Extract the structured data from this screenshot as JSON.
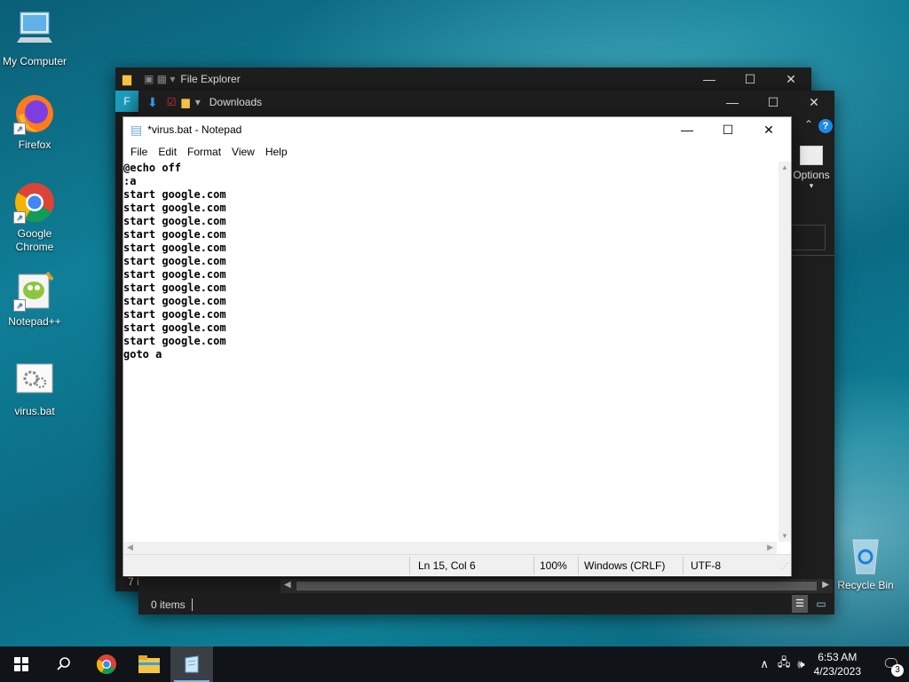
{
  "desktop": {
    "icons": [
      {
        "label": "My Computer"
      },
      {
        "label": "Firefox"
      },
      {
        "label": "Google Chrome"
      },
      {
        "label": "Notepad++"
      },
      {
        "label": "virus.bat"
      },
      {
        "label": "Recycle Bin"
      }
    ]
  },
  "explorer_back": {
    "title": "File Explorer",
    "tab_letter": "F",
    "status_partial": "7 i"
  },
  "explorer_front": {
    "title": "Downloads",
    "ribbon_options": "Options",
    "status_items": "0 items"
  },
  "notepad": {
    "title": "*virus.bat - Notepad",
    "menu": [
      "File",
      "Edit",
      "Format",
      "View",
      "Help"
    ],
    "content": "@echo off\n:a\nstart google.com\nstart google.com\nstart google.com\nstart google.com\nstart google.com\nstart google.com\nstart google.com\nstart google.com\nstart google.com\nstart google.com\nstart google.com\nstart google.com\ngoto a",
    "status": {
      "position": "Ln 15, Col 6",
      "zoom": "100%",
      "line_ending": "Windows (CRLF)",
      "encoding": "UTF-8"
    }
  },
  "taskbar": {
    "time": "6:53 AM",
    "date": "4/23/2023",
    "notification_count": "3"
  }
}
